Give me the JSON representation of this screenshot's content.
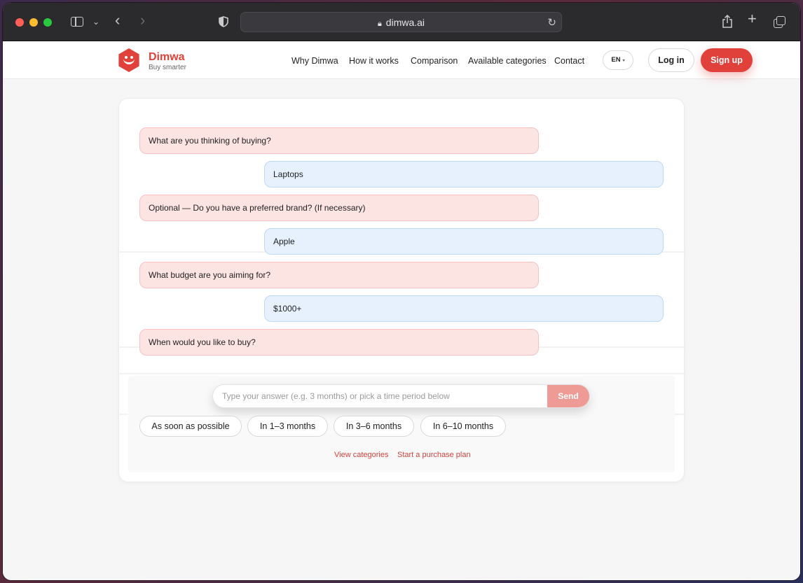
{
  "browser": {
    "url": "dimwa.ai"
  },
  "site": {
    "brand_name": "Dimwa",
    "brand_tagline": "Buy smarter",
    "nav": [
      "Why Dimwa",
      "How it works",
      "Comparison",
      "Available categories",
      "Contact"
    ],
    "language": "EN",
    "login_label": "Log in",
    "signup_label": "Sign up"
  },
  "chat": {
    "messages": [
      {
        "role": "question",
        "text": "What are you thinking of buying?"
      },
      {
        "role": "answer",
        "text": "Laptops"
      },
      {
        "role": "question",
        "text": "Optional — Do you have a preferred brand? (If necessary)"
      },
      {
        "role": "answer",
        "text": "Apple"
      },
      {
        "role": "question",
        "text": "What budget are you aiming for?"
      },
      {
        "role": "answer",
        "text": "$1000+"
      },
      {
        "role": "question",
        "text": "When would you like to buy?"
      }
    ],
    "input_placeholder": "Type your answer (e.g. 3 months) or pick a time period below",
    "send_label": "Send",
    "options": [
      "As soon as possible",
      "In 1–3 months",
      "In 3–6 months",
      "In 6–10 months"
    ],
    "links": [
      "View categories",
      "Start a purchase plan"
    ]
  },
  "colors": {
    "accent": "#e0413b",
    "question_bg": "#fce4e3",
    "answer_bg": "#e6f1fd"
  }
}
